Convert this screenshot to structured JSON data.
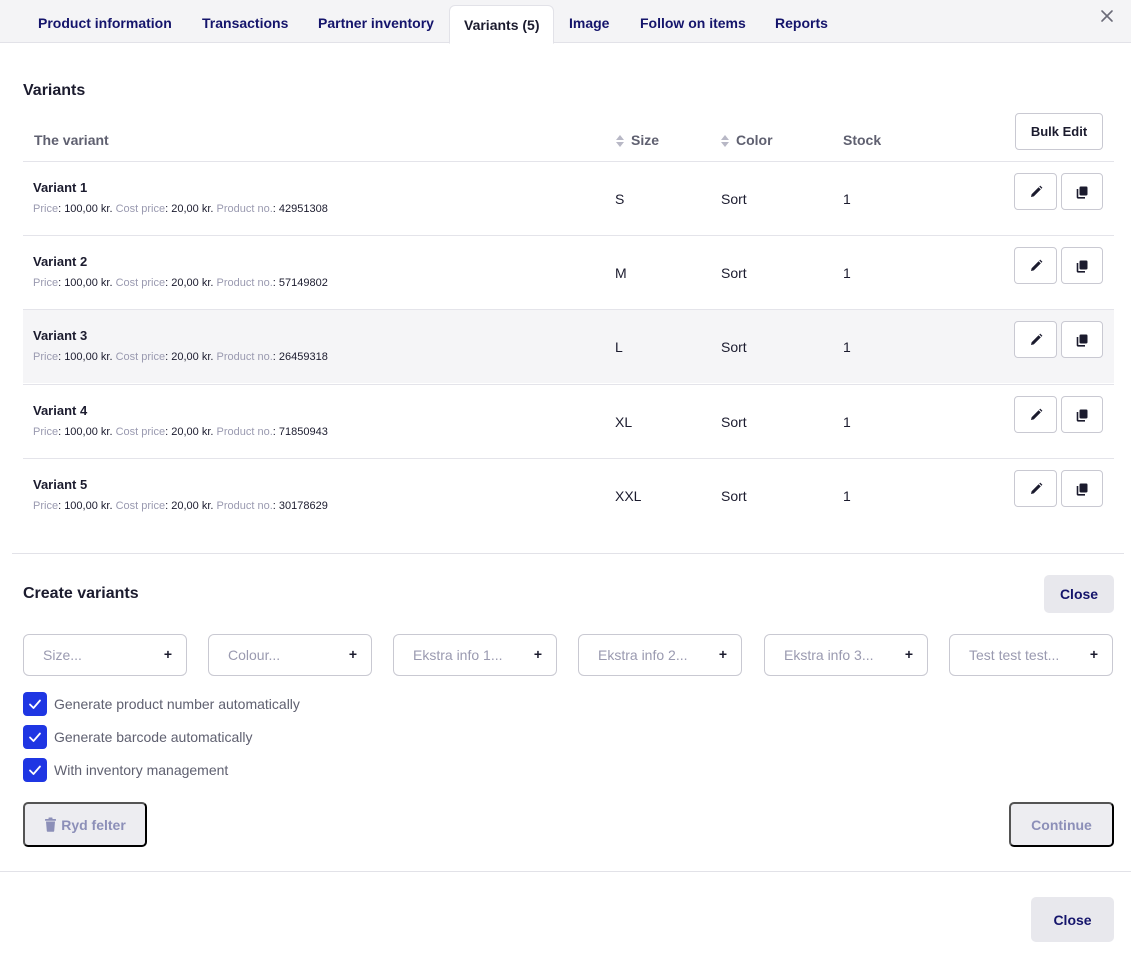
{
  "tabs": [
    {
      "label": "Product information"
    },
    {
      "label": "Transactions"
    },
    {
      "label": "Partner inventory"
    },
    {
      "label": "Variants (5)"
    },
    {
      "label": "Image"
    },
    {
      "label": "Follow on items"
    },
    {
      "label": "Reports"
    }
  ],
  "variants_section": {
    "title": "Variants",
    "bulk_edit_label": "Bulk Edit",
    "columns": {
      "variant": "The variant",
      "size": "Size",
      "color": "Color",
      "stock": "Stock"
    },
    "meta_labels": {
      "price": "Price",
      "cost_price": "Cost price",
      "product_no": "Product no."
    },
    "rows": [
      {
        "name": "Variant 1",
        "price": "100,00 kr.",
        "cost_price": "20,00 kr.",
        "product_no": "42951308",
        "size": "S",
        "color": "Sort",
        "stock": "1"
      },
      {
        "name": "Variant 2",
        "price": "100,00 kr.",
        "cost_price": "20,00 kr.",
        "product_no": "57149802",
        "size": "M",
        "color": "Sort",
        "stock": "1"
      },
      {
        "name": "Variant 3",
        "price": "100,00 kr.",
        "cost_price": "20,00 kr.",
        "product_no": "26459318",
        "size": "L",
        "color": "Sort",
        "stock": "1"
      },
      {
        "name": "Variant 4",
        "price": "100,00 kr.",
        "cost_price": "20,00 kr.",
        "product_no": "71850943",
        "size": "XL",
        "color": "Sort",
        "stock": "1"
      },
      {
        "name": "Variant 5",
        "price": "100,00 kr.",
        "cost_price": "20,00 kr.",
        "product_no": "30178629",
        "size": "XXL",
        "color": "Sort",
        "stock": "1"
      }
    ]
  },
  "create_section": {
    "title": "Create variants",
    "close_label": "Close",
    "attributes": [
      {
        "placeholder": "Size...",
        "plus": "+"
      },
      {
        "placeholder": "Colour...",
        "plus": "+"
      },
      {
        "placeholder": "Ekstra info 1...",
        "plus": "+"
      },
      {
        "placeholder": "Ekstra info 2...",
        "plus": "+"
      },
      {
        "placeholder": "Ekstra info 3...",
        "plus": "+"
      },
      {
        "placeholder": "Test test test...",
        "plus": "+"
      }
    ],
    "checkboxes": [
      {
        "label": "Generate product number automatically",
        "checked": true
      },
      {
        "label": "Generate barcode automatically",
        "checked": true
      },
      {
        "label": "With inventory management",
        "checked": true
      }
    ],
    "clear_label": "Ryd felter",
    "continue_label": "Continue"
  },
  "footer": {
    "close_label": "Close"
  },
  "icons": {
    "close": "close-icon",
    "edit": "pencil-icon",
    "copy": "copy-icon",
    "trash": "trash-icon",
    "check": "check-icon",
    "sort": "sort-icon"
  },
  "colors": {
    "accent": "#1f36e3",
    "tab_text": "#14146b",
    "muted": "#9a9ab0"
  }
}
